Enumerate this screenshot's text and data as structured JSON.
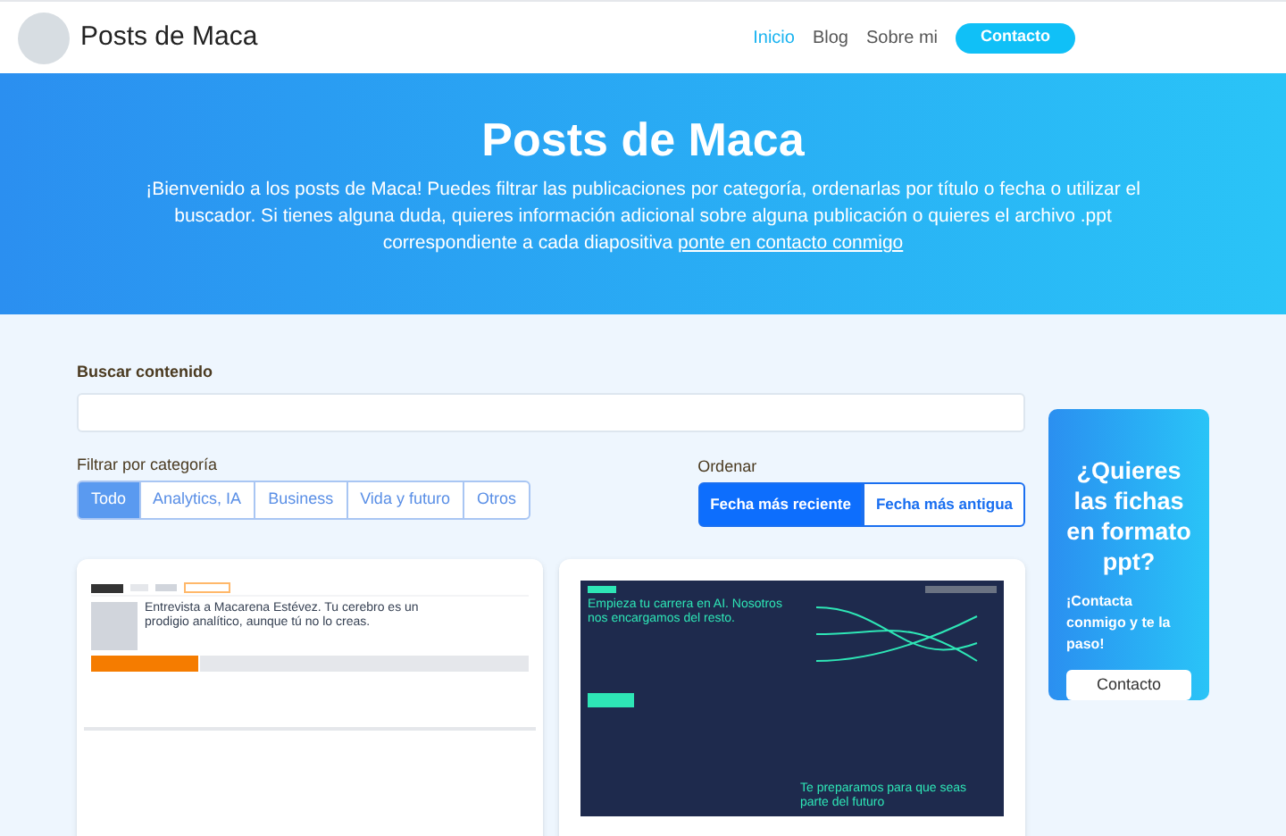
{
  "header": {
    "site_title": "Posts de Maca",
    "nav": [
      {
        "label": "Inicio",
        "selected": true
      },
      {
        "label": "Blog",
        "selected": false
      },
      {
        "label": "Sobre mi",
        "selected": false
      }
    ],
    "contact_button": "Contacto"
  },
  "hero": {
    "title": "Posts de Maca",
    "text": "¡Bienvenido a los posts de Maca! Puedes filtrar las publicaciones por categoría, ordenarlas por título o fecha o utilizar el buscador. Si tienes alguna duda, quieres información adicional sobre alguna publicación o quieres el archivo .ppt correspondiente a cada diapositiva",
    "link": "ponte en contacto conmigo"
  },
  "search": {
    "label": "Buscar contenido"
  },
  "filter": {
    "label": "Filtrar por categoría",
    "categories": [
      {
        "label": "Todo",
        "selected": true
      },
      {
        "label": "Analytics, IA",
        "selected": false
      },
      {
        "label": "Business",
        "selected": false
      },
      {
        "label": "Vida y futuro",
        "selected": false
      },
      {
        "label": "Otros",
        "selected": false
      }
    ]
  },
  "sort": {
    "label": "Ordenar",
    "options": [
      {
        "label": "Fecha más reciente",
        "selected": true
      },
      {
        "label": "Fecha más antigua",
        "selected": false
      }
    ]
  },
  "posts": [
    {
      "kind": "podcast",
      "headline": "Entrevista a Macarena Estévez. Tu cerebro es un prodigio analítico, aunque tú no lo creas."
    },
    {
      "kind": "landing",
      "headline": "Empieza tu carrera en AI. Nosotros nos encargamos del resto.",
      "subheadline": "Te preparamos para que seas parte del futuro"
    }
  ],
  "sidebar_card": {
    "title": "¿Quieres las fichas en formato ppt?",
    "text": "¡Contacta conmigo y te la paso!",
    "button": "Contacto"
  }
}
